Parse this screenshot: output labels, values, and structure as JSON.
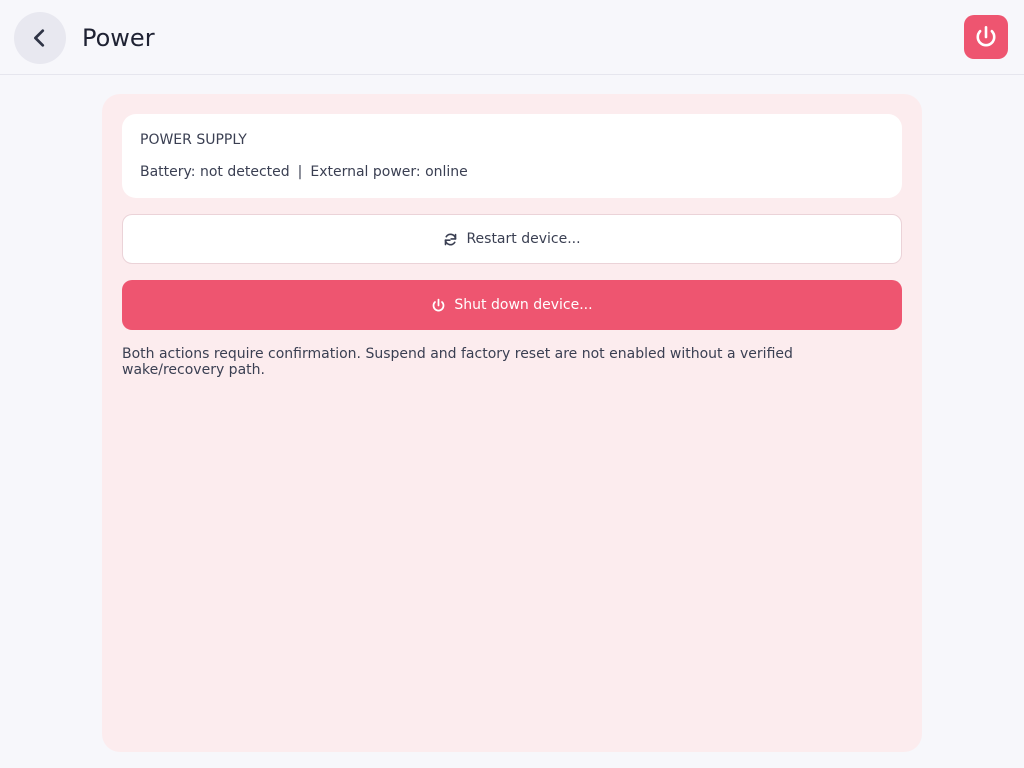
{
  "header": {
    "title": "Power",
    "back_icon": "chevron-left-icon",
    "power_icon": "power-icon"
  },
  "power_supply": {
    "title": "POWER SUPPLY",
    "battery": "Battery: not detected",
    "separator": "|",
    "external": "External power: online"
  },
  "actions": {
    "restart_label": "Restart device...",
    "restart_icon": "refresh-icon",
    "shutdown_label": "Shut down device...",
    "shutdown_icon": "power-icon"
  },
  "note": "Both actions require confirmation. Suspend and factory reset are not enabled without a verified wake/recovery path.",
  "colors": {
    "accent": "#ee5570",
    "panel_background": "#fcecee",
    "page_background": "#f7f7fb"
  }
}
